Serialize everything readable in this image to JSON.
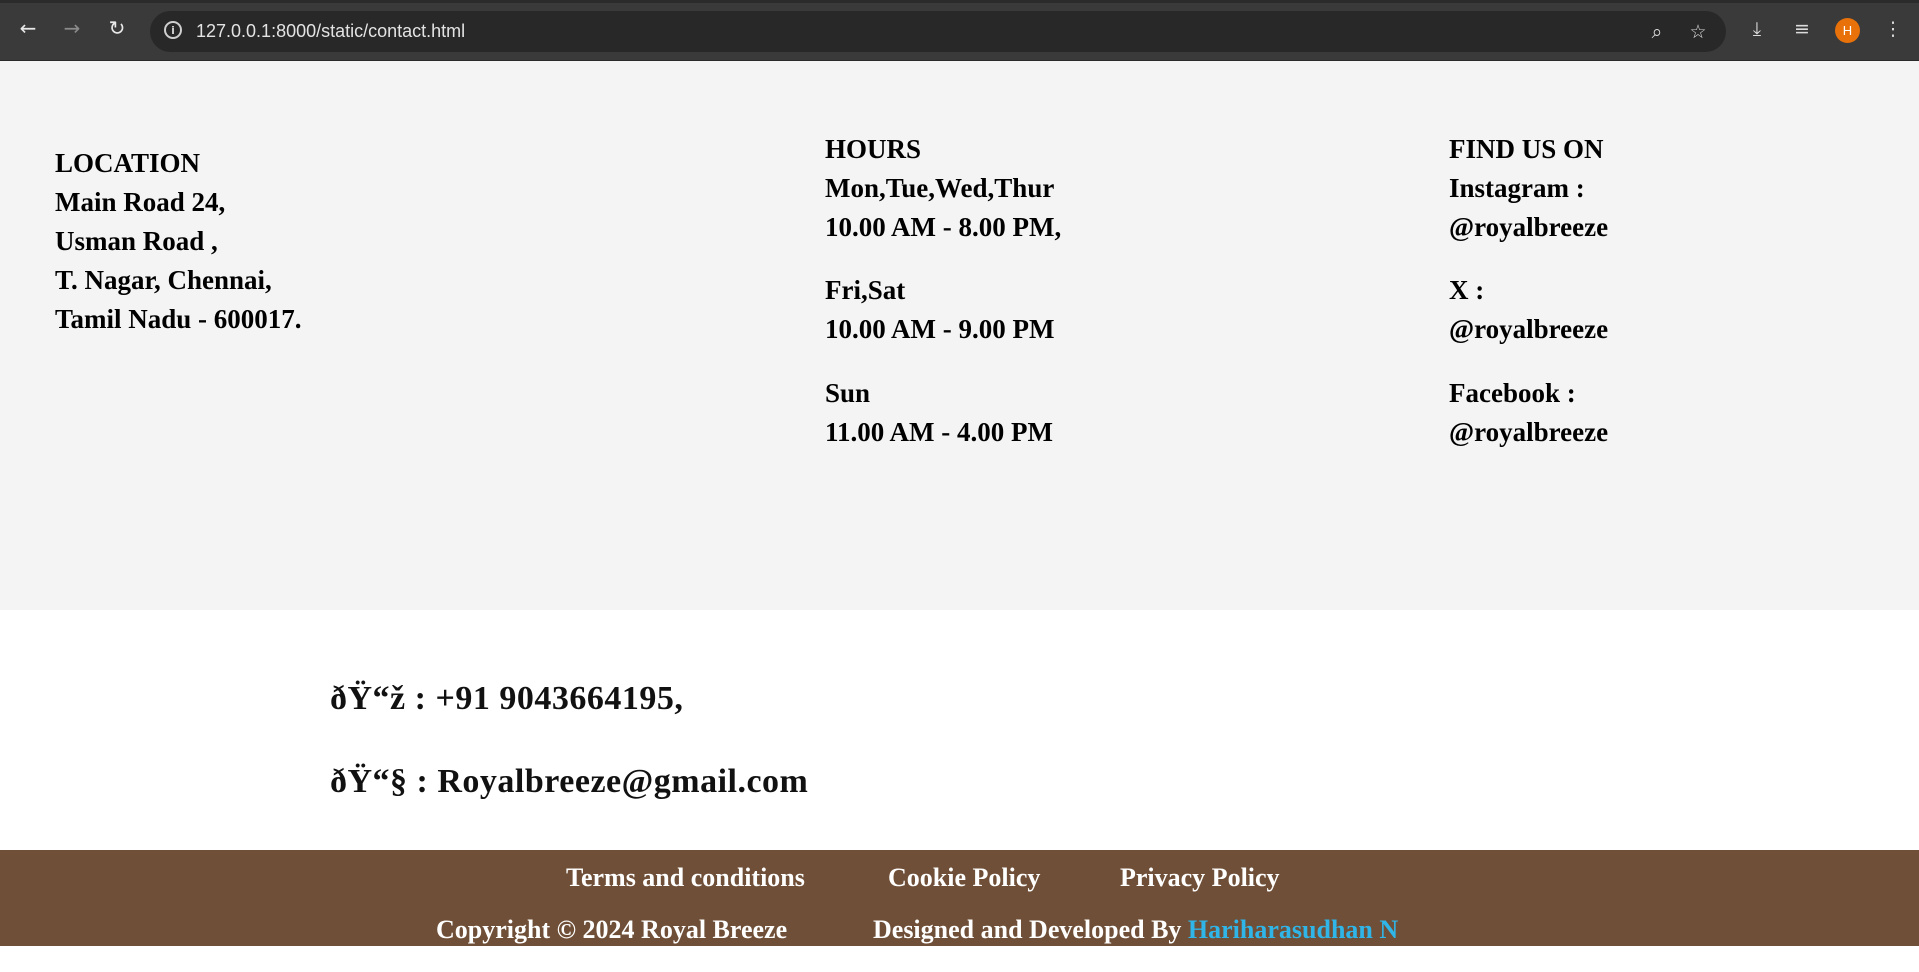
{
  "browser": {
    "url": "127.0.0.1:8000/static/contact.html",
    "profile_initial": "H",
    "accent_color": "#e8710a"
  },
  "location": {
    "heading": "LOCATION",
    "lines": [
      "Main Road 24,",
      "Usman Road ,",
      "T. Nagar, Chennai,",
      "Tamil Nadu - 600017."
    ]
  },
  "hours": {
    "heading": "HOURS",
    "groups": [
      {
        "days": "Mon,Tue,Wed,Thur",
        "time": "10.00 AM - 8.00 PM,"
      },
      {
        "days": "Fri,Sat",
        "time": "10.00 AM - 9.00 PM"
      },
      {
        "days": "Sun",
        "time": "11.00 AM - 4.00 PM"
      }
    ]
  },
  "social": {
    "heading": "FIND US ON",
    "items": [
      {
        "label": "Instagram :",
        "handle": "@royalbreeze"
      },
      {
        "label": "X :",
        "handle": "@royalbreeze"
      },
      {
        "label": "Facebook :",
        "handle": "@royalbreeze"
      }
    ]
  },
  "contact": {
    "phone": "ðŸ“ž : +91 9043664195,",
    "email": "ðŸ“§ : Royalbreeze@gmail.com"
  },
  "footer": {
    "links": [
      "Terms and conditions",
      "Cookie Policy",
      "Privacy Policy"
    ],
    "copyright": "Copyright © 2024 Royal Breeze",
    "designed_prefix": "Designed and Developed By",
    "developer": "Hariharasudhan N",
    "background_color": "#6f4f37",
    "developer_color": "#2fb5e8"
  }
}
